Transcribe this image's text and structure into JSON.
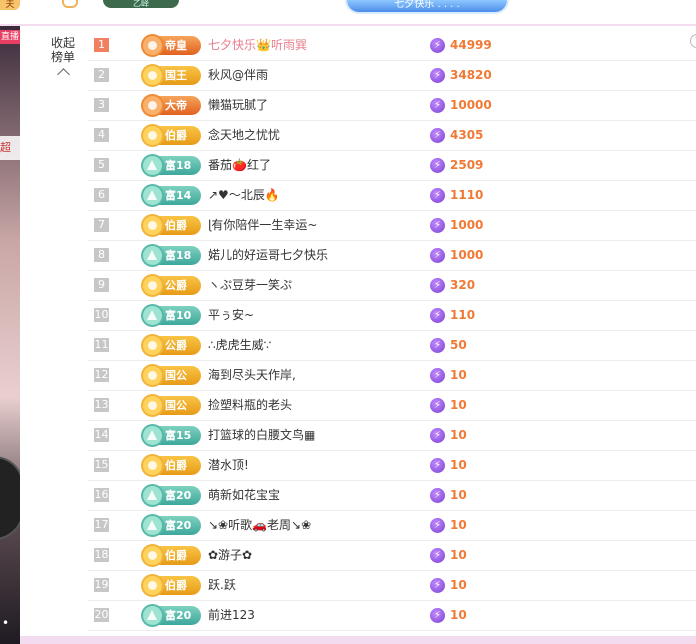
{
  "top": {
    "left_fragment": "夫",
    "pill_text": "乙峄",
    "badge_text": "七夕快乐 . . . ."
  },
  "left_strip": {
    "tag1": "直播",
    "tag2": "超"
  },
  "panel": {
    "collapse_label": "收起榜单",
    "help_glyph": "?",
    "gift_glyph": "⚡",
    "rows": [
      {
        "rank": "1",
        "level": "帝皇",
        "badge": "orange",
        "name": "七夕快乐👑听雨巽",
        "amount": "44999"
      },
      {
        "rank": "2",
        "level": "国王",
        "badge": "gold",
        "name": "秋风@伴雨",
        "amount": "34820"
      },
      {
        "rank": "3",
        "level": "大帝",
        "badge": "orange",
        "name": "懒猫玩腻了",
        "amount": "10000"
      },
      {
        "rank": "4",
        "level": "伯爵",
        "badge": "gold",
        "name": "念天地之忧忧",
        "amount": "4305"
      },
      {
        "rank": "5",
        "level": "富18",
        "badge": "teal",
        "name": "番茄🍅红了",
        "amount": "2509"
      },
      {
        "rank": "6",
        "level": "富14",
        "badge": "teal",
        "name": "↗♥～北辰🔥",
        "amount": "1110"
      },
      {
        "rank": "7",
        "level": "伯爵",
        "badge": "gold",
        "name": "ɭ有你陪伴一生幸运~",
        "amount": "1000"
      },
      {
        "rank": "8",
        "level": "富18",
        "badge": "teal",
        "name": "婼儿的好运哥七夕快乐",
        "amount": "1000"
      },
      {
        "rank": "9",
        "level": "公爵",
        "badge": "gold",
        "name": "ヽぷ豆芽一笑ぷ",
        "amount": "320"
      },
      {
        "rank": "10",
        "level": "富10",
        "badge": "teal",
        "name": "平ぅ安~",
        "amount": "110"
      },
      {
        "rank": "11",
        "level": "公爵",
        "badge": "gold",
        "name": "∴虎虎生威∵",
        "amount": "50"
      },
      {
        "rank": "12",
        "level": "国公",
        "badge": "gold",
        "name": "海到尽头天作岸,",
        "amount": "10"
      },
      {
        "rank": "13",
        "level": "国公",
        "badge": "gold",
        "name": "捡塑料瓶的老头",
        "amount": "10"
      },
      {
        "rank": "14",
        "level": "富15",
        "badge": "teal",
        "name": "打篮球的白腰文鸟▦",
        "amount": "10"
      },
      {
        "rank": "15",
        "level": "伯爵",
        "badge": "gold",
        "name": "潜水顶!",
        "amount": "10"
      },
      {
        "rank": "16",
        "level": "富20",
        "badge": "teal",
        "name": "萌新如花宝宝",
        "amount": "10"
      },
      {
        "rank": "17",
        "level": "富20",
        "badge": "teal",
        "name": "↘❀听歌🚗老周↘❀",
        "amount": "10"
      },
      {
        "rank": "18",
        "level": "伯爵",
        "badge": "gold",
        "name": "✿游子✿",
        "amount": "10"
      },
      {
        "rank": "19",
        "level": "伯爵",
        "badge": "gold",
        "name": "跃.跃",
        "amount": "10"
      },
      {
        "rank": "20",
        "level": "富20",
        "badge": "teal",
        "name": "前进123",
        "amount": "10"
      }
    ]
  },
  "colors": {
    "accent_amount": "#f07a35",
    "rank1": "#f0805f",
    "page_bg": "#f3dcef"
  }
}
